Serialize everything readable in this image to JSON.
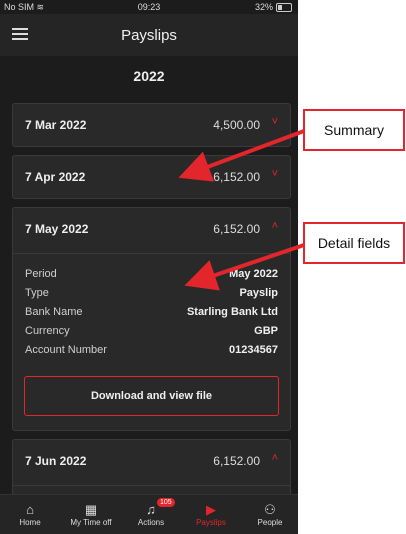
{
  "status": {
    "carrier": "No SIM",
    "time": "09:23",
    "battery": "32%"
  },
  "header": {
    "title": "Payslips"
  },
  "year": "2022",
  "payslips": [
    {
      "date": "7 Mar 2022",
      "amount": "4,500.00",
      "chevron": "˅"
    },
    {
      "date": "7 Apr 2022",
      "amount": "6,152.00",
      "chevron": "˅"
    },
    {
      "date": "7 May 2022",
      "amount": "6,152.00",
      "chevron": "˄",
      "details": [
        {
          "label": "Period",
          "value": "May 2022"
        },
        {
          "label": "Type",
          "value": "Payslip"
        },
        {
          "label": "Bank Name",
          "value": "Starling Bank Ltd"
        },
        {
          "label": "Currency",
          "value": "GBP"
        },
        {
          "label": "Account Number",
          "value": "01234567"
        }
      ],
      "download_label": "Download and view file"
    },
    {
      "date": "7 Jun 2022",
      "amount": "6,152.00",
      "chevron": "˄"
    }
  ],
  "tabs": [
    {
      "label": "Home",
      "icon": "home-icon"
    },
    {
      "label": "My Time off",
      "icon": "calendar-icon"
    },
    {
      "label": "Actions",
      "icon": "bell-icon",
      "badge": "105"
    },
    {
      "label": "Payslips",
      "icon": "payslip-icon",
      "active": true
    },
    {
      "label": "People",
      "icon": "people-icon"
    }
  ],
  "annotations": [
    {
      "label": "Summary"
    },
    {
      "label": "Detail fields"
    }
  ],
  "colors": {
    "accent": "#e3262b",
    "background": "#1c1c1c",
    "card": "#292929"
  }
}
